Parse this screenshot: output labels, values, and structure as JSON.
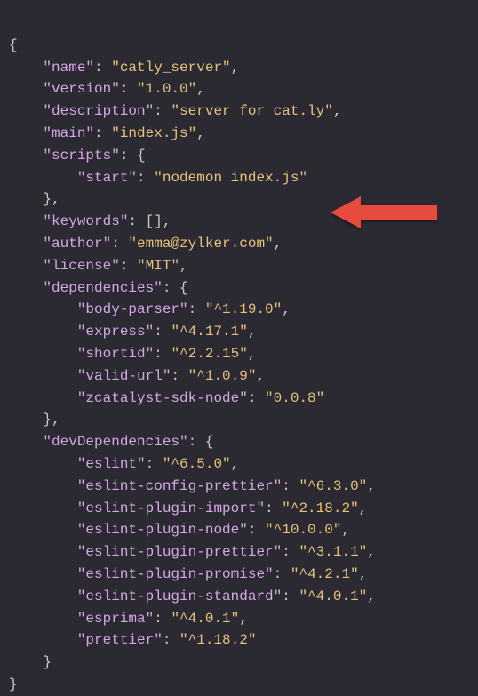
{
  "pkg": {
    "name_key": "\"name\"",
    "name_val": "\"catly_server\"",
    "version_key": "\"version\"",
    "version_val": "\"1.0.0\"",
    "description_key": "\"description\"",
    "description_val": "\"server for cat.ly\"",
    "main_key": "\"main\"",
    "main_val": "\"index.js\"",
    "scripts_key": "\"scripts\"",
    "start_key": "\"start\"",
    "start_val": "\"nodemon index.js\"",
    "keywords_key": "\"keywords\"",
    "author_key": "\"author\"",
    "author_val": "\"emma@zylker.com\"",
    "license_key": "\"license\"",
    "license_val": "\"MIT\"",
    "dependencies_key": "\"dependencies\"",
    "dep1_key": "\"body-parser\"",
    "dep1_val": "\"^1.19.0\"",
    "dep2_key": "\"express\"",
    "dep2_val": "\"^4.17.1\"",
    "dep3_key": "\"shortid\"",
    "dep3_val": "\"^2.2.15\"",
    "dep4_key": "\"valid-url\"",
    "dep4_val": "\"^1.0.9\"",
    "dep5_key": "\"zcatalyst-sdk-node\"",
    "dep5_val": "\"0.0.8\"",
    "devDependencies_key": "\"devDependencies\"",
    "dev1_key": "\"eslint\"",
    "dev1_val": "\"^6.5.0\"",
    "dev2_key": "\"eslint-config-prettier\"",
    "dev2_val": "\"^6.3.0\"",
    "dev3_key": "\"eslint-plugin-import\"",
    "dev3_val": "\"^2.18.2\"",
    "dev4_key": "\"eslint-plugin-node\"",
    "dev4_val": "\"^10.0.0\"",
    "dev5_key": "\"eslint-plugin-prettier\"",
    "dev5_val": "\"^3.1.1\"",
    "dev6_key": "\"eslint-plugin-promise\"",
    "dev6_val": "\"^4.2.1\"",
    "dev7_key": "\"eslint-plugin-standard\"",
    "dev7_val": "\"^4.0.1\"",
    "dev8_key": "\"esprima\"",
    "dev8_val": "\"^4.0.1\"",
    "dev9_key": "\"prettier\"",
    "dev9_val": "\"^1.18.2\""
  },
  "arrow_color": "#e74c3c"
}
